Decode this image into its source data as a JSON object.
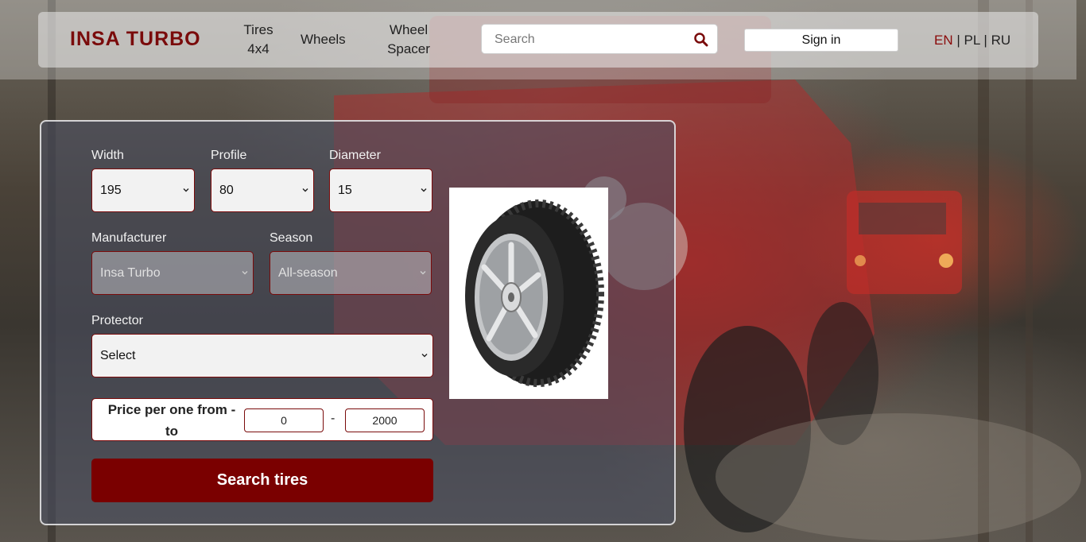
{
  "header": {
    "logo": "INSA TURBO",
    "nav": [
      "Tires 4x4",
      "Wheels",
      "Wheel Spacer"
    ],
    "search_placeholder": "Search",
    "sign_in": "Sign in",
    "languages": {
      "en": "EN",
      "pl": "PL",
      "ru": "RU",
      "separator": "|",
      "active": "EN"
    }
  },
  "form": {
    "width": {
      "label": "Width",
      "value": "195"
    },
    "profile": {
      "label": "Profile",
      "value": "80"
    },
    "diameter": {
      "label": "Diameter",
      "value": "15"
    },
    "manufacturer": {
      "label": "Manufacturer",
      "value": "Insa Turbo"
    },
    "season": {
      "label": "Season",
      "value": "All-season"
    },
    "protector": {
      "label": "Protector",
      "value": "Select"
    },
    "price": {
      "label": "Price per one from - to",
      "from": "0",
      "to": "2000",
      "separator": "-"
    },
    "submit": "Search tires"
  },
  "colors": {
    "brand": "#7a0b0b",
    "button": "#7a0000"
  },
  "icons": {
    "search": "search-icon",
    "chevron": "chevron-down-icon",
    "product": "tire-image"
  }
}
